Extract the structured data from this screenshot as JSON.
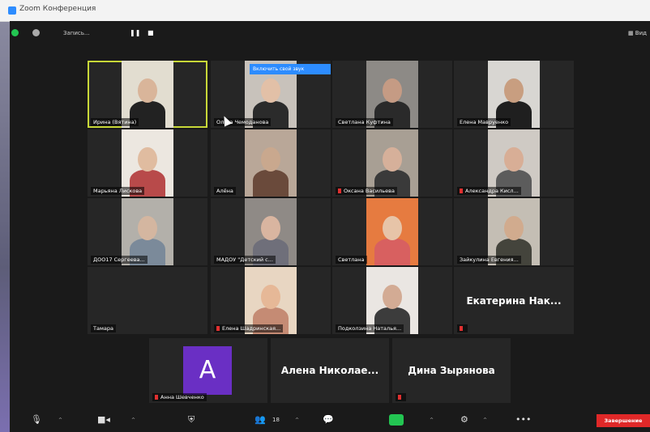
{
  "window": {
    "title": "Zoom Конференция"
  },
  "topbar": {
    "recording_label": "Запись...",
    "pause_icon": "pause-icon",
    "stop_icon": "stop-icon",
    "view_label": "Вид"
  },
  "gallery": [
    {
      "name": "Ирина (Вятина)",
      "active": true,
      "bg": "#e2ddd0",
      "skin": "#d9b59a",
      "shirt": "#222"
    },
    {
      "name": "Ольга Чемоданова",
      "bg": "#c8c2bb",
      "skin": "#e2c0a7",
      "shirt": "#2b2b2b"
    },
    {
      "name": "Светлана Куфтина",
      "bg": "#8d8a86",
      "skin": "#c59b84",
      "shirt": "#2a2a2a"
    },
    {
      "name": "Елена Мавруенко",
      "bg": "#d8d6d2",
      "skin": "#c89e80",
      "shirt": "#1f1f1f"
    },
    {
      "name": "Марьяна Лискова",
      "bg": "#ece7e0",
      "skin": "#e0bca0",
      "shirt": "#b84a4a"
    },
    {
      "name": "Алёна",
      "bg": "#b9a798",
      "skin": "#c9a88e",
      "shirt": "#6a4a3b"
    },
    {
      "name": "Оксана Васильева",
      "mic_muted": true,
      "bg": "#a89f94",
      "skin": "#d6b09a",
      "shirt": "#3a3a3a"
    },
    {
      "name": "Александра Кисл...",
      "mic_muted": true,
      "bg": "#cfcac4",
      "skin": "#d8ae96",
      "shirt": "#5c5c5c"
    },
    {
      "name": "ДОО17 Сергеева...",
      "bg": "#b3b0aa",
      "skin": "#d4b6a0",
      "shirt": "#7b8a9a"
    },
    {
      "name": "МАДОУ \"Детский с...",
      "bg": "#8f8a86",
      "skin": "#d9b5a0",
      "shirt": "#6f6f7a"
    },
    {
      "name": "Светлана",
      "bg": "#e67b40",
      "skin": "#e7c4a8",
      "shirt": "#d86060"
    },
    {
      "name": "Зайкулина Евгения...",
      "bg": "#c4beb4",
      "skin": "#d1ab8e",
      "shirt": "#44443c"
    },
    {
      "name": "Тамара",
      "bg": "",
      "skin": "",
      "shirt": ""
    },
    {
      "name": "Елена Шадринская...",
      "mic_muted": true,
      "bg": "#e8d6c2",
      "skin": "#e6b897",
      "shirt": "#c58b74"
    },
    {
      "name": "Подколзина Наталья...",
      "bg": "#eae6e2",
      "skin": "#d3ab94",
      "shirt": "#3c3c3c"
    },
    {
      "name": "",
      "display_name": "Екатерина  Нак...",
      "mic_muted": true
    }
  ],
  "bottom_row": [
    {
      "name": "Анна Шевченко",
      "avatar_letter": "A",
      "mic_muted": true
    },
    {
      "display_name": "Алена  Николае..."
    },
    {
      "display_name": "Дина Зырянова",
      "mic_muted": true
    }
  ],
  "unmute_prompt": "Включить свой звук",
  "toolbar": {
    "participants_count": "18",
    "end_label": "Завершение",
    "icons": [
      "mic-icon",
      "video-icon",
      "security-icon",
      "participants-icon",
      "chat-icon",
      "share-icon",
      "record-icon",
      "more-icon"
    ]
  },
  "colors": {
    "accent_green": "#23c552",
    "end_red": "#e02828",
    "speaker_outline": "#c8d838",
    "avatar_purple": "#6a2fc4",
    "unmute_blue": "#2d8cff"
  }
}
